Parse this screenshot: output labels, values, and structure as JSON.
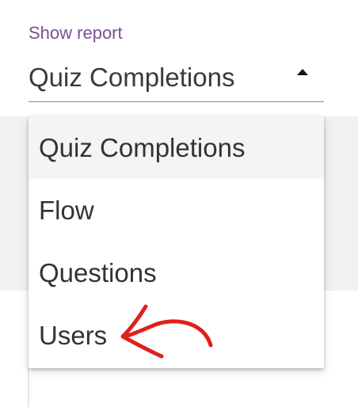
{
  "report_select": {
    "label": "Show report",
    "value": "Quiz Completions",
    "arrow_icon": "triangle-up-icon",
    "options": [
      {
        "label": "Quiz Completions",
        "selected": true
      },
      {
        "label": "Flow",
        "selected": false
      },
      {
        "label": "Questions",
        "selected": false
      },
      {
        "label": "Users",
        "selected": false
      }
    ]
  },
  "annotation": {
    "icon": "red-arrow-icon",
    "color": "#e0201c"
  },
  "colors": {
    "label": "#7b4f91",
    "text": "#333333",
    "selected_option_bg": "#f4f4f4",
    "underline": "#8a8a8a"
  }
}
